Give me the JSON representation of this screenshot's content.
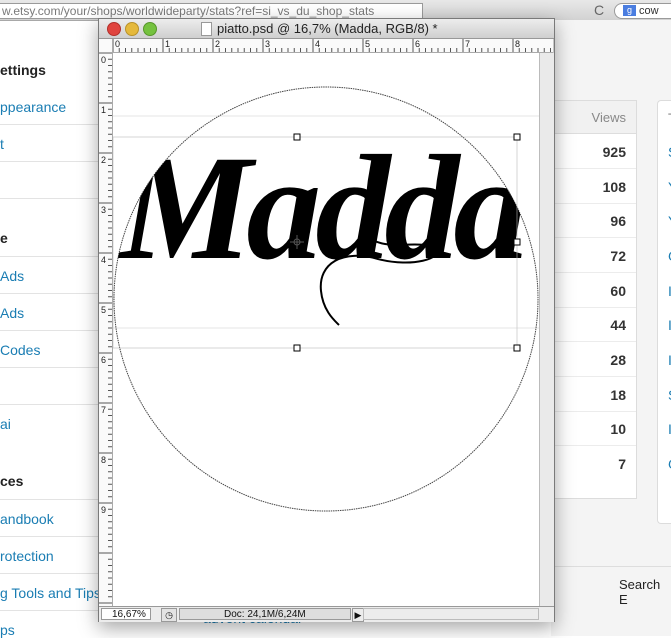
{
  "browser": {
    "url": "w.etsy.com/your/shops/worldwideparty/stats?ref=si_vs_du_shop_stats",
    "reload_glyph": "C",
    "search_text": "cow"
  },
  "sidebar": {
    "items": [
      {
        "label": "ettings",
        "kind": "heading"
      },
      {
        "label": "ppearance",
        "kind": "link"
      },
      {
        "label": "t",
        "kind": "link"
      },
      {
        "label": "e",
        "kind": "heading"
      },
      {
        "label": "Ads",
        "kind": "link"
      },
      {
        "label": "Ads",
        "kind": "link"
      },
      {
        "label": "Codes",
        "kind": "link"
      },
      {
        "label": "ai",
        "kind": "link"
      },
      {
        "label": "ces",
        "kind": "heading"
      },
      {
        "label": "andbook",
        "kind": "link"
      },
      {
        "label": "rotection",
        "kind": "link"
      },
      {
        "label": "g Tools and Tips",
        "kind": "link"
      },
      {
        "label": "ps",
        "kind": "link"
      }
    ]
  },
  "stats": {
    "views_header": "Views",
    "views": [
      "925",
      "108",
      "96",
      "72",
      "60",
      "44",
      "28",
      "18",
      "10",
      "7"
    ],
    "second_header": "T",
    "second_col_letters": [
      "S",
      "Y",
      "Y",
      "G",
      "I",
      "I",
      "I",
      "S",
      "I",
      "G"
    ],
    "search_button": "Search E",
    "advent_link": "advent calendar"
  },
  "photoshop": {
    "title": "piatto.psd @ 16,7% (Madda, RGB/8) *",
    "zoom": "16,67%",
    "doc_info": "Doc: 24,1M/6,24M",
    "ruler_top": [
      "0",
      "1",
      "2",
      "3",
      "4",
      "5",
      "6",
      "7",
      "8"
    ],
    "ruler_left": [
      "0",
      "1",
      "2",
      "3",
      "4",
      "5",
      "6",
      "7",
      "8",
      "9"
    ],
    "canvas_text": "Madda"
  }
}
